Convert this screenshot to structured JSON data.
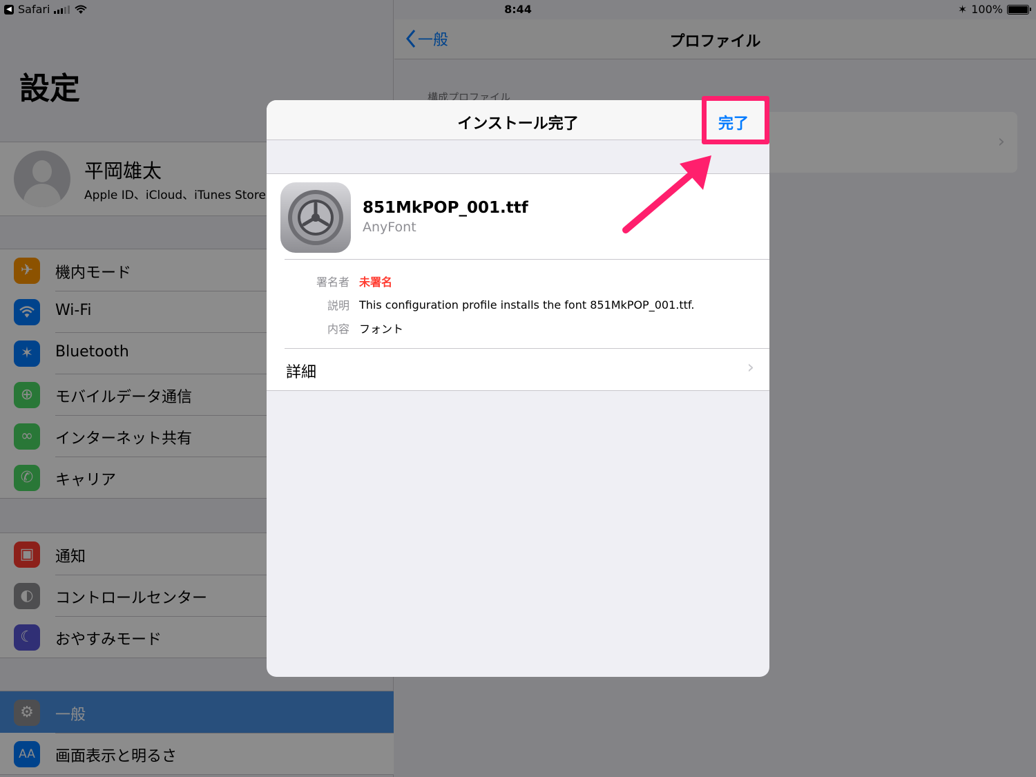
{
  "status_bar": {
    "back_app": "Safari",
    "time": "8:44",
    "battery": "100%"
  },
  "left_pane": {
    "title": "設定",
    "profile": {
      "name": "平岡雄太",
      "subtitle": "Apple ID、iCloud、iTunes Storeと"
    },
    "group1": [
      {
        "label": "機内モード",
        "icon": "airplane-icon",
        "color": "#ff9500"
      },
      {
        "label": "Wi-Fi",
        "icon": "wifi-icon",
        "color": "#007aff"
      },
      {
        "label": "Bluetooth",
        "icon": "bluetooth-icon",
        "color": "#007aff"
      },
      {
        "label": "モバイルデータ通信",
        "icon": "antenna-icon",
        "color": "#4cd964"
      },
      {
        "label": "インターネット共有",
        "icon": "link-icon",
        "color": "#4cd964"
      },
      {
        "label": "キャリア",
        "icon": "phone-icon",
        "color": "#4cd964"
      }
    ],
    "group2": [
      {
        "label": "通知",
        "icon": "notification-icon",
        "color": "#ff3b30"
      },
      {
        "label": "コントロールセンター",
        "icon": "toggles-icon",
        "color": "#8e8e93"
      },
      {
        "label": "おやすみモード",
        "icon": "moon-icon",
        "color": "#5856d6"
      }
    ],
    "group3": [
      {
        "label": "一般",
        "icon": "gear-icon",
        "color": "#8e8e93",
        "selected": true
      },
      {
        "label": "画面表示と明るさ",
        "icon": "text-size-icon",
        "color": "#007aff"
      }
    ]
  },
  "right_pane": {
    "back_label": "一般",
    "title": "プロファイル",
    "section_header": "構成プロファイル"
  },
  "modal": {
    "title": "インストール完了",
    "done_label": "完了",
    "file_name": "851MkPOP_001.ttf",
    "source": "AnyFont",
    "meta": [
      {
        "key": "署名者",
        "value": "未署名",
        "red": true
      },
      {
        "key": "説明",
        "value": "This configuration profile installs the font 851MkPOP_001.ttf.",
        "red": false
      },
      {
        "key": "内容",
        "value": "フォント",
        "red": false
      }
    ],
    "detail_label": "詳細"
  },
  "colors": {
    "accent": "#007aff",
    "annotation": "#ff1f6d",
    "selected_row": "#4a90e2",
    "unsigned": "#ff3b30"
  }
}
